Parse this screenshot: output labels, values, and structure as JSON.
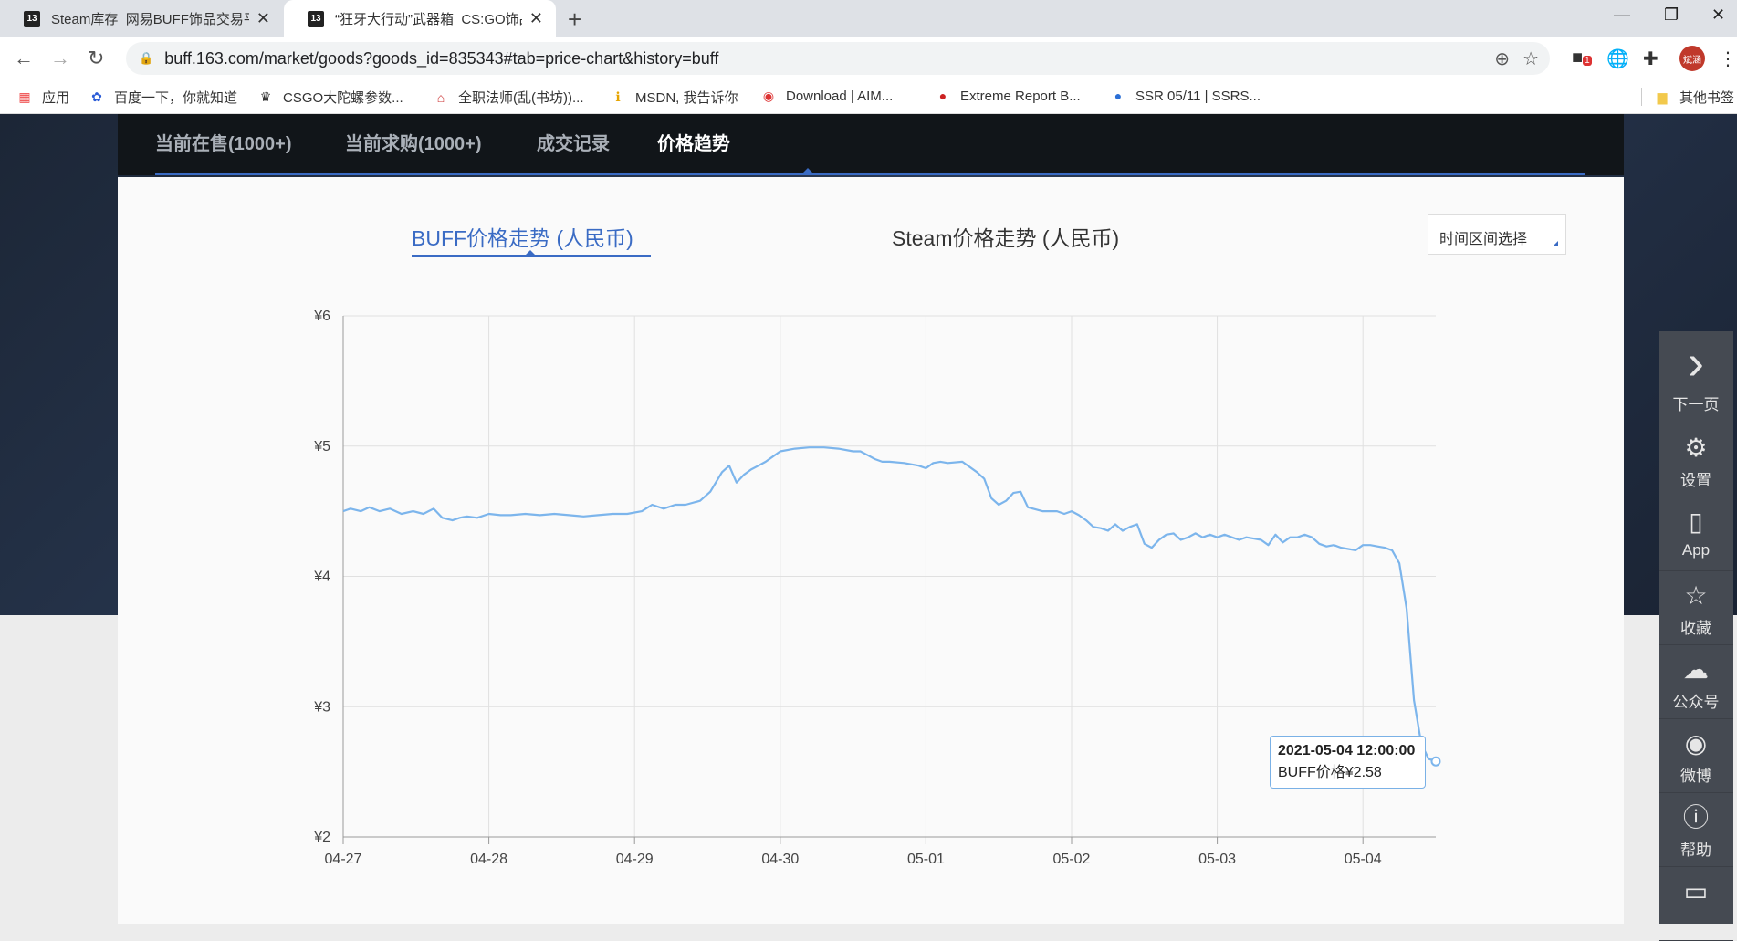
{
  "browser": {
    "tabs": [
      {
        "icon_text": "13",
        "title": "Steam库存_网易BUFF饰品交易平台"
      },
      {
        "icon_text": "13",
        "title": "“狂牙大行动”武器箱_CS:GO饰品交易"
      }
    ],
    "url": "buff.163.com/market/goods?goods_id=835343#tab=price-chart&history=buff",
    "avatar_label": "斌涵",
    "ext_badge": "1",
    "bookmarks": [
      {
        "icon": "apps-icon",
        "label": "应用"
      },
      {
        "icon": "baidu-icon",
        "label": "百度一下，你就知道"
      },
      {
        "icon": "crown-icon",
        "label": "CSGO大陀螺参数..."
      },
      {
        "icon": "house-icon",
        "label": "全职法师(乱(书坊))..."
      },
      {
        "icon": "msdn-icon",
        "label": "MSDN, 我告诉你"
      },
      {
        "icon": "download-icon",
        "label": "Download | AIM..."
      },
      {
        "icon": "steam-icon",
        "label": "Extreme Report B..."
      },
      {
        "icon": "globe-icon",
        "label": "SSR 05/11 | SSRS..."
      },
      {
        "icon": "folder-icon",
        "label": "其他书签"
      }
    ]
  },
  "market_tabs": [
    {
      "label": "当前在售(1000+)",
      "active": false
    },
    {
      "label": "当前求购(1000+)",
      "active": false
    },
    {
      "label": "成交记录",
      "active": false
    },
    {
      "label": "价格趋势",
      "active": true
    }
  ],
  "chart_tabs": {
    "buff": "BUFF价格走势 (人民币)",
    "steam": "Steam价格走势 (人民币)",
    "range_select": "时间区间选择"
  },
  "tooltip": {
    "date": "2021-05-04 12:00:00",
    "label": "BUFF价格¥2.58"
  },
  "sidebar": [
    {
      "icon": "chevron-right-icon",
      "label": "下一页"
    },
    {
      "icon": "gear-icon",
      "label": "设置"
    },
    {
      "icon": "phone-icon",
      "label": "App"
    },
    {
      "icon": "star-icon",
      "label": "收藏"
    },
    {
      "icon": "wechat-icon",
      "label": "公众号"
    },
    {
      "icon": "weibo-icon",
      "label": "微博"
    },
    {
      "icon": "help-icon",
      "label": "帮助"
    },
    {
      "icon": "comment-icon",
      "label": ""
    }
  ],
  "chart_data": {
    "type": "line",
    "title": "",
    "xlabel": "",
    "ylabel": "",
    "ylim": [
      2,
      6
    ],
    "yticks": [
      2,
      3,
      4,
      5,
      6
    ],
    "ytick_labels": [
      "¥2",
      "¥3",
      "¥4",
      "¥5",
      "¥6"
    ],
    "xlim": [
      0,
      7.5
    ],
    "xticks": [
      0,
      1,
      2,
      3,
      4,
      5,
      6,
      7
    ],
    "xtick_labels": [
      "04-27",
      "04-28",
      "04-29",
      "04-30",
      "05-01",
      "05-02",
      "05-03",
      "05-04"
    ],
    "grid": true,
    "line_color": "#7cb5ec",
    "series": [
      {
        "name": "",
        "x": [
          0,
          0.05,
          0.12,
          0.18,
          0.25,
          0.32,
          0.4,
          0.48,
          0.55,
          0.62,
          0.68,
          0.75,
          0.8,
          0.85,
          0.92,
          1.0,
          1.08,
          1.15,
          1.25,
          1.35,
          1.45,
          1.55,
          1.65,
          1.75,
          1.85,
          1.95,
          2.05,
          2.12,
          2.2,
          2.28,
          2.35,
          2.45,
          2.52,
          2.6,
          2.65,
          2.7,
          2.75,
          2.8,
          2.85,
          2.9,
          2.95,
          3.0,
          3.1,
          3.2,
          3.3,
          3.4,
          3.5,
          3.55,
          3.6,
          3.65,
          3.7,
          3.75,
          3.85,
          3.95,
          4.0,
          4.05,
          4.1,
          4.15,
          4.25,
          4.35,
          4.4,
          4.45,
          4.5,
          4.55,
          4.6,
          4.65,
          4.7,
          4.8,
          4.85,
          4.9,
          4.95,
          5.0,
          5.05,
          5.1,
          5.15,
          5.2,
          5.25,
          5.3,
          5.35,
          5.4,
          5.45,
          5.5,
          5.55,
          5.6,
          5.65,
          5.7,
          5.75,
          5.8,
          5.85,
          5.9,
          5.95,
          6.0,
          6.05,
          6.1,
          6.15,
          6.2,
          6.25,
          6.3,
          6.35,
          6.4,
          6.45,
          6.5,
          6.55,
          6.6,
          6.65,
          6.7,
          6.75,
          6.8,
          6.85,
          6.9,
          6.95,
          7.0,
          7.05,
          7.1,
          7.15,
          7.2,
          7.25,
          7.3,
          7.35,
          7.4,
          7.45,
          7.5
        ],
        "y": [
          4.5,
          4.52,
          4.5,
          4.53,
          4.5,
          4.52,
          4.48,
          4.5,
          4.48,
          4.52,
          4.45,
          4.43,
          4.45,
          4.46,
          4.45,
          4.48,
          4.47,
          4.47,
          4.48,
          4.47,
          4.48,
          4.47,
          4.46,
          4.47,
          4.48,
          4.48,
          4.5,
          4.55,
          4.52,
          4.55,
          4.55,
          4.58,
          4.65,
          4.8,
          4.85,
          4.72,
          4.78,
          4.82,
          4.85,
          4.88,
          4.92,
          4.96,
          4.98,
          4.99,
          4.99,
          4.98,
          4.96,
          4.96,
          4.93,
          4.9,
          4.88,
          4.88,
          4.87,
          4.85,
          4.83,
          4.87,
          4.88,
          4.87,
          4.88,
          4.8,
          4.75,
          4.6,
          4.55,
          4.58,
          4.64,
          4.65,
          4.53,
          4.5,
          4.5,
          4.5,
          4.48,
          4.5,
          4.47,
          4.43,
          4.38,
          4.37,
          4.35,
          4.4,
          4.35,
          4.38,
          4.4,
          4.25,
          4.22,
          4.28,
          4.32,
          4.33,
          4.28,
          4.3,
          4.33,
          4.3,
          4.32,
          4.3,
          4.32,
          4.3,
          4.28,
          4.3,
          4.29,
          4.28,
          4.24,
          4.32,
          4.26,
          4.3,
          4.3,
          4.32,
          4.3,
          4.25,
          4.23,
          4.24,
          4.22,
          4.21,
          4.2,
          4.24,
          4.24,
          4.23,
          4.22,
          4.2,
          4.1,
          3.75,
          3.05,
          2.72,
          2.6,
          2.58
        ]
      }
    ]
  }
}
